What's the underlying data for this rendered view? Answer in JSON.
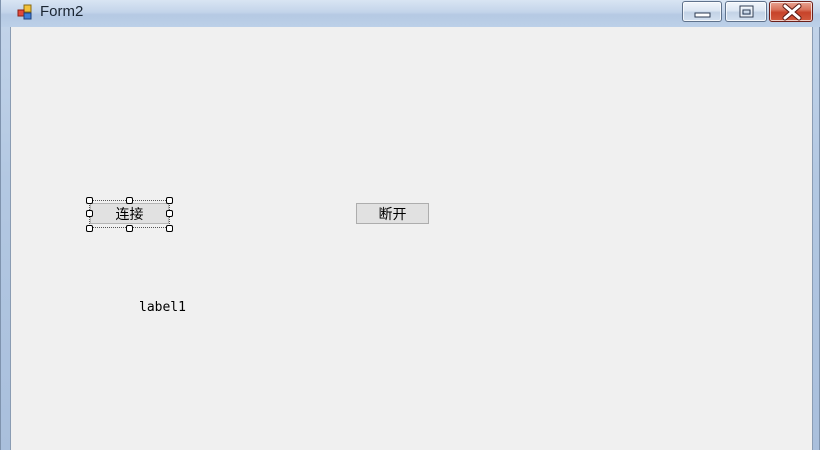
{
  "window": {
    "title": "Form2",
    "icon": "form-app-icon",
    "controls": [
      "minimize-icon",
      "maximize-icon",
      "close-icon"
    ]
  },
  "form": {
    "connect_button_label": "连接",
    "disconnect_button_label": "断开",
    "label_text": "label1"
  },
  "colors": {
    "client_background": "#f0f0f0",
    "button_face": "#e1e1e1",
    "close_button": "#c7432a"
  }
}
